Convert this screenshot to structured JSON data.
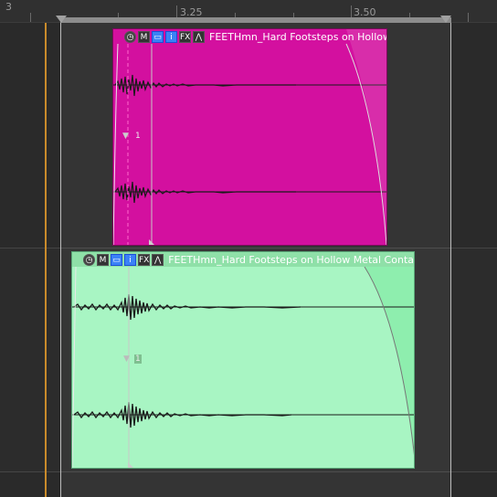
{
  "ruler": {
    "labels": [
      "3",
      "3.25",
      "3.50"
    ]
  },
  "clips": [
    {
      "title": "FEETHmn_Hard Footsteps on Hollow",
      "color": "#d3109f",
      "buttons": [
        "M",
        "FX"
      ],
      "marker": "1"
    },
    {
      "title": "FEETHmn_Hard Footsteps on Hollow Metal Conta",
      "color": "#a8f5c3",
      "buttons": [
        "M",
        "FX"
      ],
      "marker": "1"
    }
  ],
  "icons": [
    "clock-icon",
    "mute-icon",
    "folder-icon",
    "info-icon",
    "fx-icon",
    "envelope-icon",
    "marker-triangle-icon"
  ]
}
